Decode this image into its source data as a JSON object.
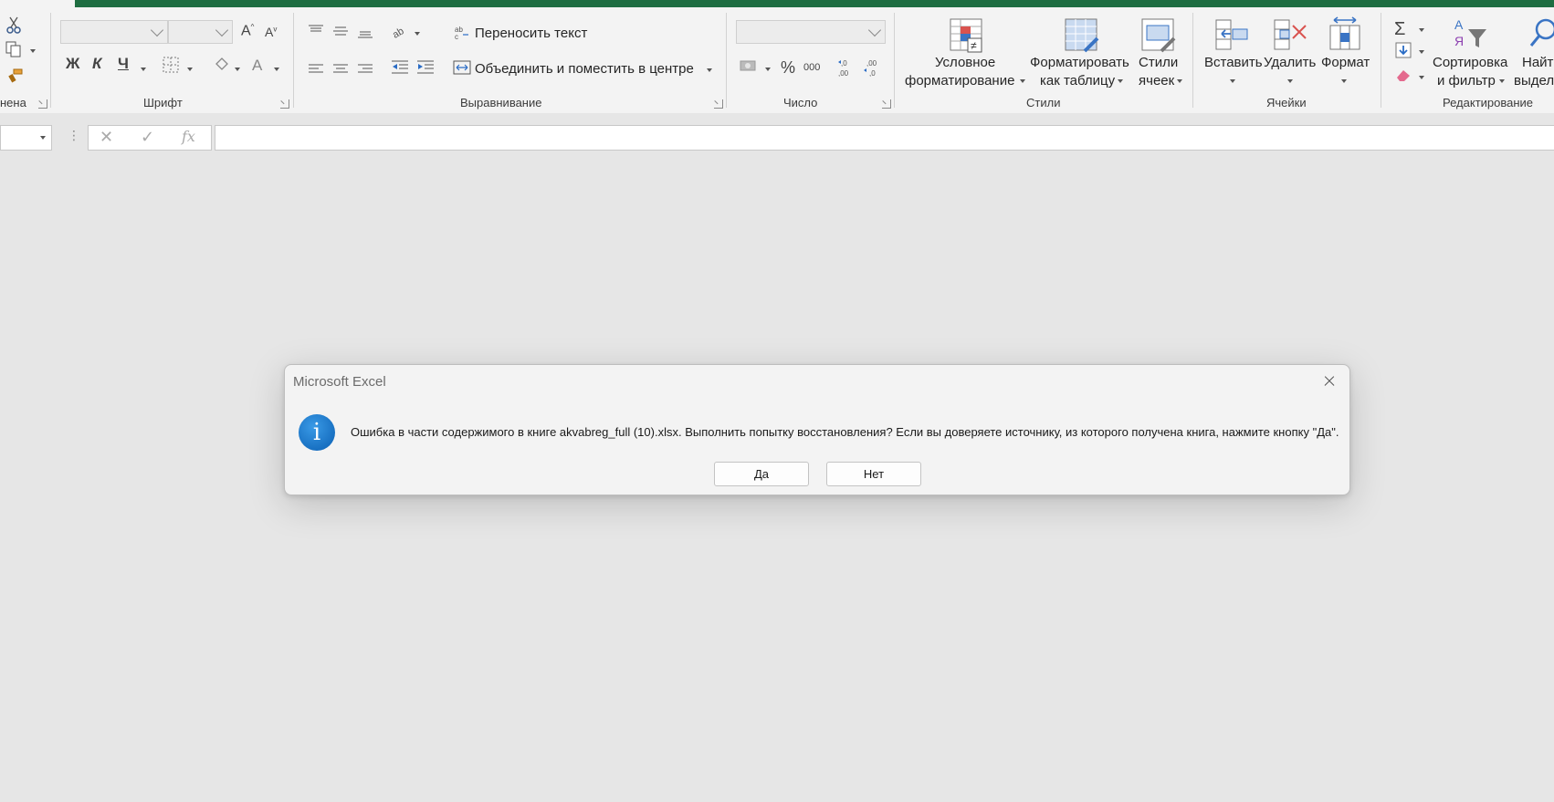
{
  "ribbon": {
    "groups": {
      "clipboard_label": "нена",
      "font_label": "Шрифт",
      "alignment_label": "Выравнивание",
      "number_label": "Число",
      "styles_label": "Стили",
      "cells_label": "Ячейки",
      "editing_label": "Редактирование"
    },
    "font": {
      "bold": "Ж",
      "italic": "К",
      "underline": "Ч"
    },
    "alignment": {
      "wrap_text": "Переносить текст",
      "merge_center": "Объединить и поместить в центре"
    },
    "number": {
      "percent": "%",
      "thousands": "000"
    },
    "styles": {
      "conditional_line1": "Условное",
      "conditional_line2": "форматирование",
      "format_table_line1": "Форматировать",
      "format_table_line2": "как таблицу",
      "cell_styles_line1": "Стили",
      "cell_styles_line2": "ячеек"
    },
    "cells": {
      "insert": "Вставить",
      "delete": "Удалить",
      "format": "Формат"
    },
    "editing": {
      "sort_line1": "Сортировка",
      "sort_line2": "и фильтр",
      "find_line1": "Найти",
      "find_line2": "выдели"
    }
  },
  "formula_bar": {
    "fx": "fx"
  },
  "dialog": {
    "title": "Microsoft Excel",
    "message": "Ошибка в части содержимого в книге akvabreg_full (10).xlsx. Выполнить попытку восстановления? Если вы доверяете источнику, из которого получена книга, нажмите кнопку \"Да\".",
    "yes_label": "Да",
    "no_label": "Нет",
    "icon": "info-icon"
  },
  "colors": {
    "accent": "#1e6d41",
    "ribbon_bg": "#f3f3f3",
    "workspace_bg": "#e6e6e6",
    "info_blue": "#0a5fb3"
  }
}
